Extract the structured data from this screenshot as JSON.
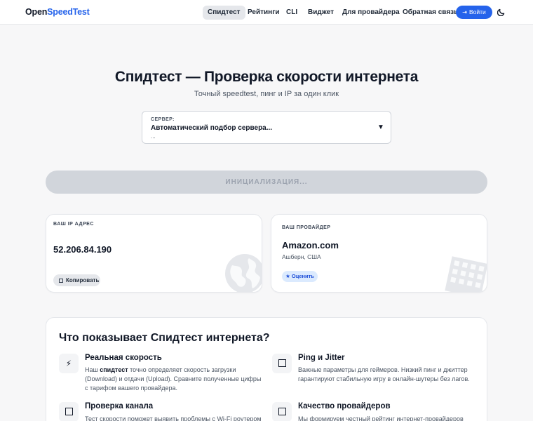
{
  "header": {
    "logo_part1": "Open",
    "logo_part2": "SpeedTest",
    "nav": [
      "Спидтест",
      "Рейтинги",
      "CLI",
      "Виджет",
      "Для провайдера",
      "Обратная связь"
    ],
    "login_label": "Войти",
    "login_icon": "login-arrow-icon",
    "theme_icon": "moon-icon"
  },
  "hero": {
    "title": "Спидтест — Проверка скорости интернета",
    "subtitle": "Точный speedtest, пинг и IP за один клик"
  },
  "server": {
    "label": "СЕРВЕР:",
    "value": "Автоматический подбор сервера...",
    "sub": "...",
    "caret": "▼"
  },
  "start_button": {
    "label": "ИНИЦИАЛИЗАЦИЯ..."
  },
  "ip_card": {
    "title": "ВАШ IP АДРЕС",
    "ip": "52.206.84.190",
    "copy_label": "Копировать",
    "icon": "globe-icon"
  },
  "isp_card": {
    "title": "ВАШ ПРОВАЙДЕР",
    "name": "Amazon.com",
    "location": "Ашберн, США",
    "rate_label": "★ Оценить",
    "icon": "building-icon"
  },
  "info": {
    "title": "Что показывает Спидтест интернета?",
    "features": [
      {
        "title": "Реальная скорость",
        "text_prefix": "Наш ",
        "text_bold": "спидтест",
        "text_rest": " точно определяет скорость загрузки (Download) и отдачи (Upload). Сравните полученные цифры с тарифом вашего провайдера.",
        "icon": "lightning-icon"
      },
      {
        "title": "Ping и Jitter",
        "text": "Важные параметры для геймеров. Низкий пинг и джиттер гарантируют стабильную игру в онлайн-шутеры без лагов.",
        "icon": "square-icon"
      },
      {
        "title": "Проверка канала",
        "text": "Тест скорости поможет выявить проблемы с Wi-Fi роутером",
        "icon": "square-icon"
      },
      {
        "title": "Качество провайдеров",
        "text": "Мы формируем честный рейтинг интернет-провайдеров",
        "icon": "square-icon"
      }
    ]
  },
  "colors": {
    "accent": "#2563eb",
    "background": "#f7f7f8",
    "button_disabled": "#d1d5db"
  }
}
